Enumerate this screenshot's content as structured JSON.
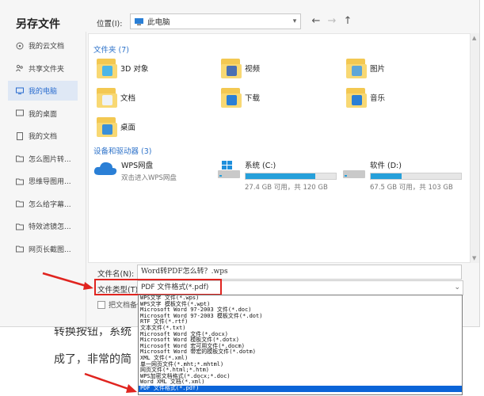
{
  "dialog": {
    "title": "另存文件",
    "location_label": "位置(I):",
    "location_value": "此电脑",
    "sidebar": [
      {
        "label": "我的云文档",
        "icon": "cloud-icon"
      },
      {
        "label": "共享文件夹",
        "icon": "share-icon"
      },
      {
        "label": "我的电脑",
        "icon": "computer-icon",
        "active": true
      },
      {
        "label": "我的桌面",
        "icon": "desktop-icon"
      },
      {
        "label": "我的文档",
        "icon": "document-icon"
      },
      {
        "label": "怎么图片转...",
        "icon": "folder-icon"
      },
      {
        "label": "思维导图用...",
        "icon": "folder-icon"
      },
      {
        "label": "怎么给字幕...",
        "icon": "folder-icon"
      },
      {
        "label": "特效滤镜怎...",
        "icon": "folder-icon"
      },
      {
        "label": "网页长截图...",
        "icon": "folder-icon"
      }
    ],
    "folders_header": "文件夹 (7)",
    "folders": [
      {
        "name": "3D 对象",
        "color": "#4bb6e8"
      },
      {
        "name": "视频",
        "color": "#4a6fb3"
      },
      {
        "name": "图片",
        "color": "#5fa6d8"
      },
      {
        "name": "文档",
        "color": "#eef2f6"
      },
      {
        "name": "下载",
        "color": "#2a7fd6"
      },
      {
        "name": "音乐",
        "color": "#2a7fd6"
      },
      {
        "name": "桌面",
        "color": "#3a8fd8"
      }
    ],
    "devices_header": "设备和驱动器 (3)",
    "devices": [
      {
        "name": "WPS网盘",
        "sub": "双击进入WPS网盘",
        "type": "cloud"
      },
      {
        "name": "系统 (C:)",
        "sub": "27.4 GB 可用，共 120 GB",
        "used": 0.77,
        "type": "drive"
      },
      {
        "name": "软件 (D:)",
        "sub": "67.5 GB 可用，共 103 GB",
        "used": 0.34,
        "type": "drive"
      }
    ],
    "filename_label": "文件名(N):",
    "filename_value": "Word转PDF怎么转？.wps",
    "filetype_label": "文件类型(T):",
    "filetype_value": "PDF 文件格式(*.pdf)",
    "checkbox_label": "把文档备份",
    "filetype_options": [
      "WPS文字 文件(*.wps)",
      "WPS文字 模板文件(*.wpt)",
      "Microsoft Word 97-2003 文件(*.doc)",
      "Microsoft Word 97-2003 模板文件(*.dot)",
      "RTF 文件(*.rtf)",
      "文本文件(*.txt)",
      "Microsoft Word 文件(*.docx)",
      "Microsoft Word 模板文件(*.dotx)",
      "Microsoft Word 宏可用文件(*.docm)",
      "Microsoft Word 带宏的模板文件(*.dotm)",
      "XML 文件(*.xml)",
      "单一网页文件(*.mht;*.mhtml)",
      "网页文件(*.html;*.htm)",
      "WPS加密文档格式(*.docx;*.doc)",
      "Word XML 文档(*.xml)",
      "PDF 文件格式(*.pdf)"
    ],
    "selected_option_index": 15
  },
  "background_doc": {
    "line1": "转换按钮，系统",
    "line2": "成了，非常的简"
  },
  "colors": {
    "accent": "#2d72c9",
    "highlight_red": "#e0241f",
    "selection": "#0a64d8"
  }
}
